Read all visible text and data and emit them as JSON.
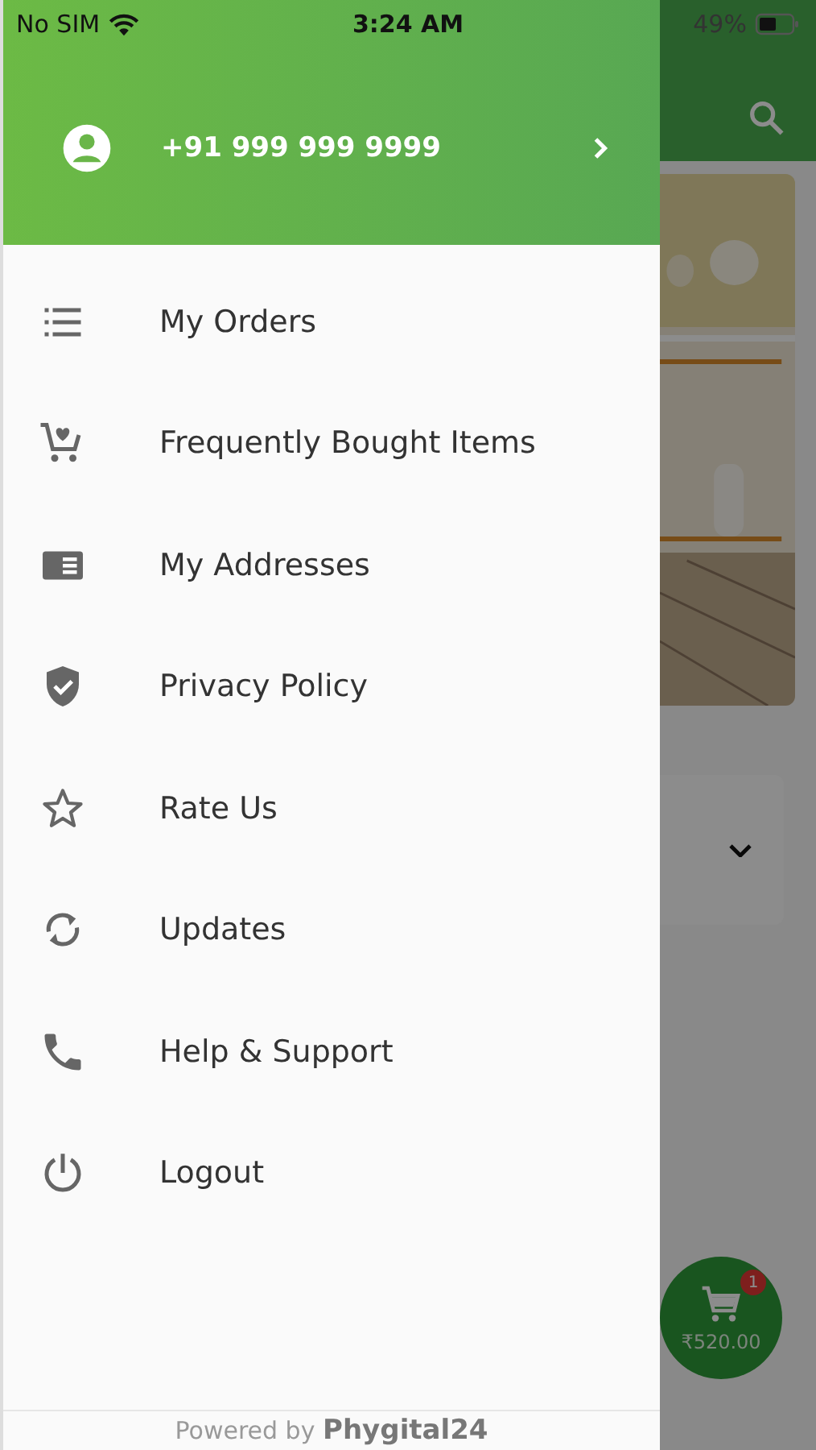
{
  "status_bar": {
    "carrier": "No SIM",
    "time": "3:24 AM",
    "battery": "49%"
  },
  "drawer": {
    "header": {
      "phone": "+91 999 999 9999"
    },
    "items": [
      {
        "kind": "orders",
        "label": "My Orders"
      },
      {
        "kind": "cart",
        "label": "Frequently Bought Items"
      },
      {
        "kind": "address",
        "label": "My Addresses"
      },
      {
        "kind": "shield",
        "label": "Privacy Policy"
      },
      {
        "kind": "star",
        "label": "Rate Us"
      },
      {
        "kind": "sync",
        "label": "Updates"
      },
      {
        "kind": "phone",
        "label": "Help & Support"
      },
      {
        "kind": "power",
        "label": "Logout"
      }
    ],
    "footer": {
      "prefix": "Powered by",
      "brand": "Phygital24"
    }
  },
  "background": {
    "cart": {
      "badge": "1",
      "total": "₹520.00"
    }
  }
}
